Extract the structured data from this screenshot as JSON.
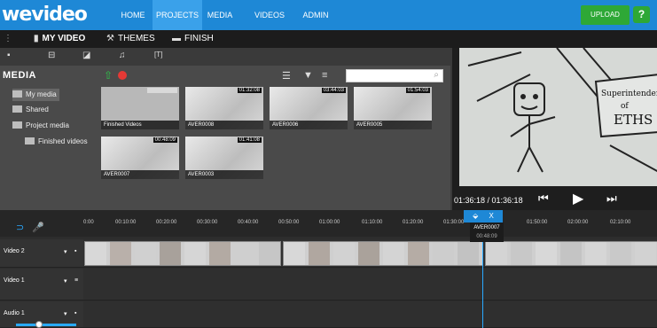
{
  "logo": "wevideo",
  "nav": {
    "items": [
      {
        "label": "HOME",
        "active": false
      },
      {
        "label": "PROJECTS",
        "active": true
      },
      {
        "label": "MEDIA",
        "active": false
      },
      {
        "label": "VIDEOS",
        "active": false
      },
      {
        "label": "ADMIN",
        "active": false
      }
    ],
    "upload_label": "UPLOAD",
    "help_label": "?"
  },
  "tabs": [
    {
      "label": "MY VIDEO",
      "icon": "film-icon"
    },
    {
      "label": "THEMES",
      "icon": "magic-wand-icon"
    },
    {
      "label": "FINISH",
      "icon": "clapper-icon"
    }
  ],
  "media": {
    "title": "MEDIA",
    "search_placeholder": "",
    "tree": [
      {
        "label": "My media",
        "selected": true
      },
      {
        "label": "Shared",
        "selected": false
      },
      {
        "label": "Project media",
        "selected": false
      },
      {
        "label": "Finished videos",
        "selected": false
      }
    ],
    "items": [
      {
        "caption": "Finished Videos",
        "duration": ""
      },
      {
        "caption": "AVER0008",
        "duration": "01:32:08"
      },
      {
        "caption": "AVER0006",
        "duration": "03:44:03"
      },
      {
        "caption": "AVER0005",
        "duration": "01:54:03"
      },
      {
        "caption": "AVER0007",
        "duration": "00:48:09"
      },
      {
        "caption": "AVER0003",
        "duration": "01:41:08"
      }
    ]
  },
  "preview": {
    "timecode": "01:36:18 / 01:36:18",
    "whiteboard_text": [
      "Superintendent",
      "of",
      "ETHS"
    ]
  },
  "timeline": {
    "ticks": [
      "0:00",
      "00:10:00",
      "00:20:00",
      "00:30:00",
      "00:40:00",
      "00:50:00",
      "01:00:00",
      "01:10:00",
      "01:20:00",
      "01:30:00",
      "01:50:00",
      "02:00:00",
      "02:10:00"
    ],
    "playhead_close": "X",
    "playhead_clip": "AVER0007",
    "playhead_time": "00:48:09",
    "tracks": [
      {
        "label": "Video 2"
      },
      {
        "label": "Video 1"
      },
      {
        "label": "Audio 1"
      }
    ]
  },
  "colors": {
    "nav_bg": "#1e88d6",
    "accent": "#29a9ff",
    "upload_green": "#2ea836",
    "record_red": "#e53935"
  }
}
